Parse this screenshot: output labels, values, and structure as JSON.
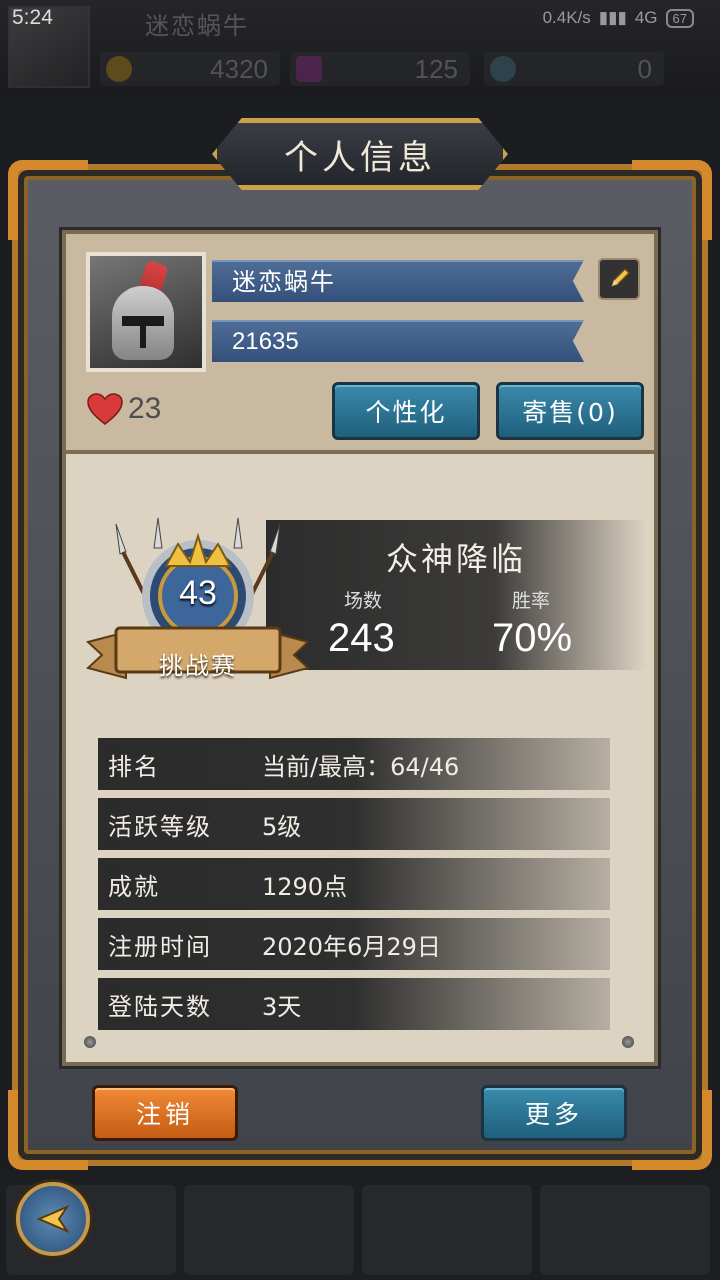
{
  "status_bar": {
    "time": "5:24",
    "network_speed": "0.4K/s",
    "network_type": "4G",
    "battery": "67"
  },
  "background_header": {
    "player_name": "迷恋蜗牛",
    "gold": "4320",
    "gems": "125",
    "tokens": "0"
  },
  "dialog": {
    "title": "个人信息",
    "player_name": "迷恋蜗牛",
    "player_id": "21635",
    "likes": "23",
    "personalize_label": "个性化",
    "consign_label": "寄售(0)",
    "mode": {
      "title": "众神降临",
      "matches_label": "场数",
      "matches_value": "243",
      "winrate_label": "胜率",
      "winrate_value": "70%",
      "badge_level": "43",
      "badge_label": "挑战赛"
    },
    "info_rows": [
      {
        "label": "排名",
        "value": "当前/最高：64/46"
      },
      {
        "label": "活跃等级",
        "value": "5级"
      },
      {
        "label": "成就",
        "value": "1290点"
      },
      {
        "label": "注册时间",
        "value": "2020年6月29日"
      },
      {
        "label": "登陆天数",
        "value": "3天"
      }
    ],
    "logout_label": "注销",
    "more_label": "更多"
  },
  "colors": {
    "frame_gold": "#b07a2a",
    "panel_bg": "#ddd3c3",
    "blue_button": "#2c7797",
    "orange_button": "#e07a28",
    "bar_blue": "#42618b"
  }
}
